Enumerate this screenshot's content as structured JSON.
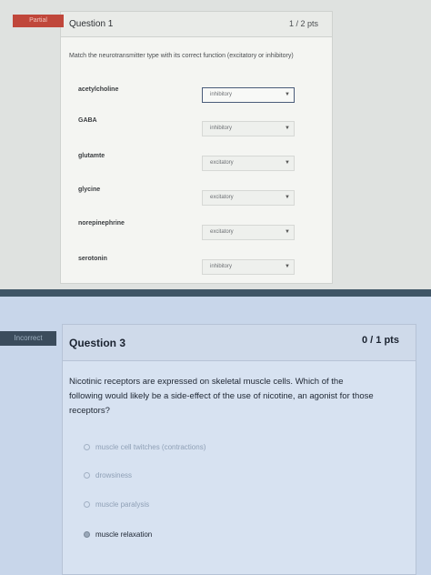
{
  "question1": {
    "badge": "Partial",
    "title": "Question 1",
    "points": "1 / 2 pts",
    "prompt": "Match the neurotransmitter type with its correct function (excitatory or inhibitory)",
    "matches": [
      {
        "term": "acetylcholine",
        "selected": "inhibitory"
      },
      {
        "term": "GABA",
        "selected": "inhibitory"
      },
      {
        "term": "glutamte",
        "selected": "excitatory"
      },
      {
        "term": "glycine",
        "selected": "excitatory"
      },
      {
        "term": "norepinephrine",
        "selected": "excitatory"
      },
      {
        "term": "serotonin",
        "selected": "inhibitory"
      }
    ]
  },
  "question3": {
    "badge": "Incorrect",
    "title": "Question 3",
    "points": "0 / 1 pts",
    "prompt": "Nicotinic receptors are expressed on skeletal muscle cells. Which of the following would likely be a side-effect of the use of nicotine, an agonist for those receptors?",
    "answers": [
      "muscle cell twitches (contractions)",
      "drowsiness",
      "muscle paralysis",
      "muscle relaxation"
    ],
    "selected_answer": "muscle relaxation"
  },
  "icons": {
    "chevron": "chevron-down-icon",
    "radio": "radio-icon"
  }
}
